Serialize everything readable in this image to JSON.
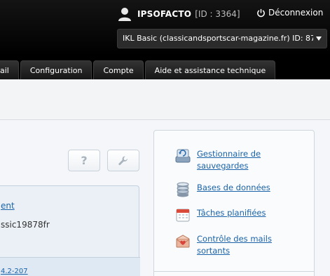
{
  "header": {
    "user_name": "IPSOFACTO",
    "user_id": "[ID : 3364]",
    "logout_label": "Déconnexion",
    "account_selected": "IKL Basic (classicandsportscar-magazine.fr) ID: 87"
  },
  "tabs": [
    {
      "label": "ail"
    },
    {
      "label": "Configuration"
    },
    {
      "label": "Compte"
    },
    {
      "label": "Aide et assistance technique"
    }
  ],
  "toolbar": {
    "help_label": "?"
  },
  "left_panel": {
    "link_text": "ent",
    "value_text": "ssic19878fr",
    "bottom_link": "4.2-207"
  },
  "right_panel": {
    "items": [
      {
        "label": "Gestionnaire de sauvegardes",
        "icon": "backup-icon"
      },
      {
        "label": "Bases de données",
        "icon": "database-icon"
      },
      {
        "label": "Tâches planifiées",
        "icon": "calendar-icon"
      },
      {
        "label": "Contrôle des mails sortants",
        "icon": "mail-icon"
      }
    ]
  },
  "colors": {
    "header_bg": "#000000",
    "link": "#1a63a8",
    "panel_bg": "#eaf0f6"
  }
}
